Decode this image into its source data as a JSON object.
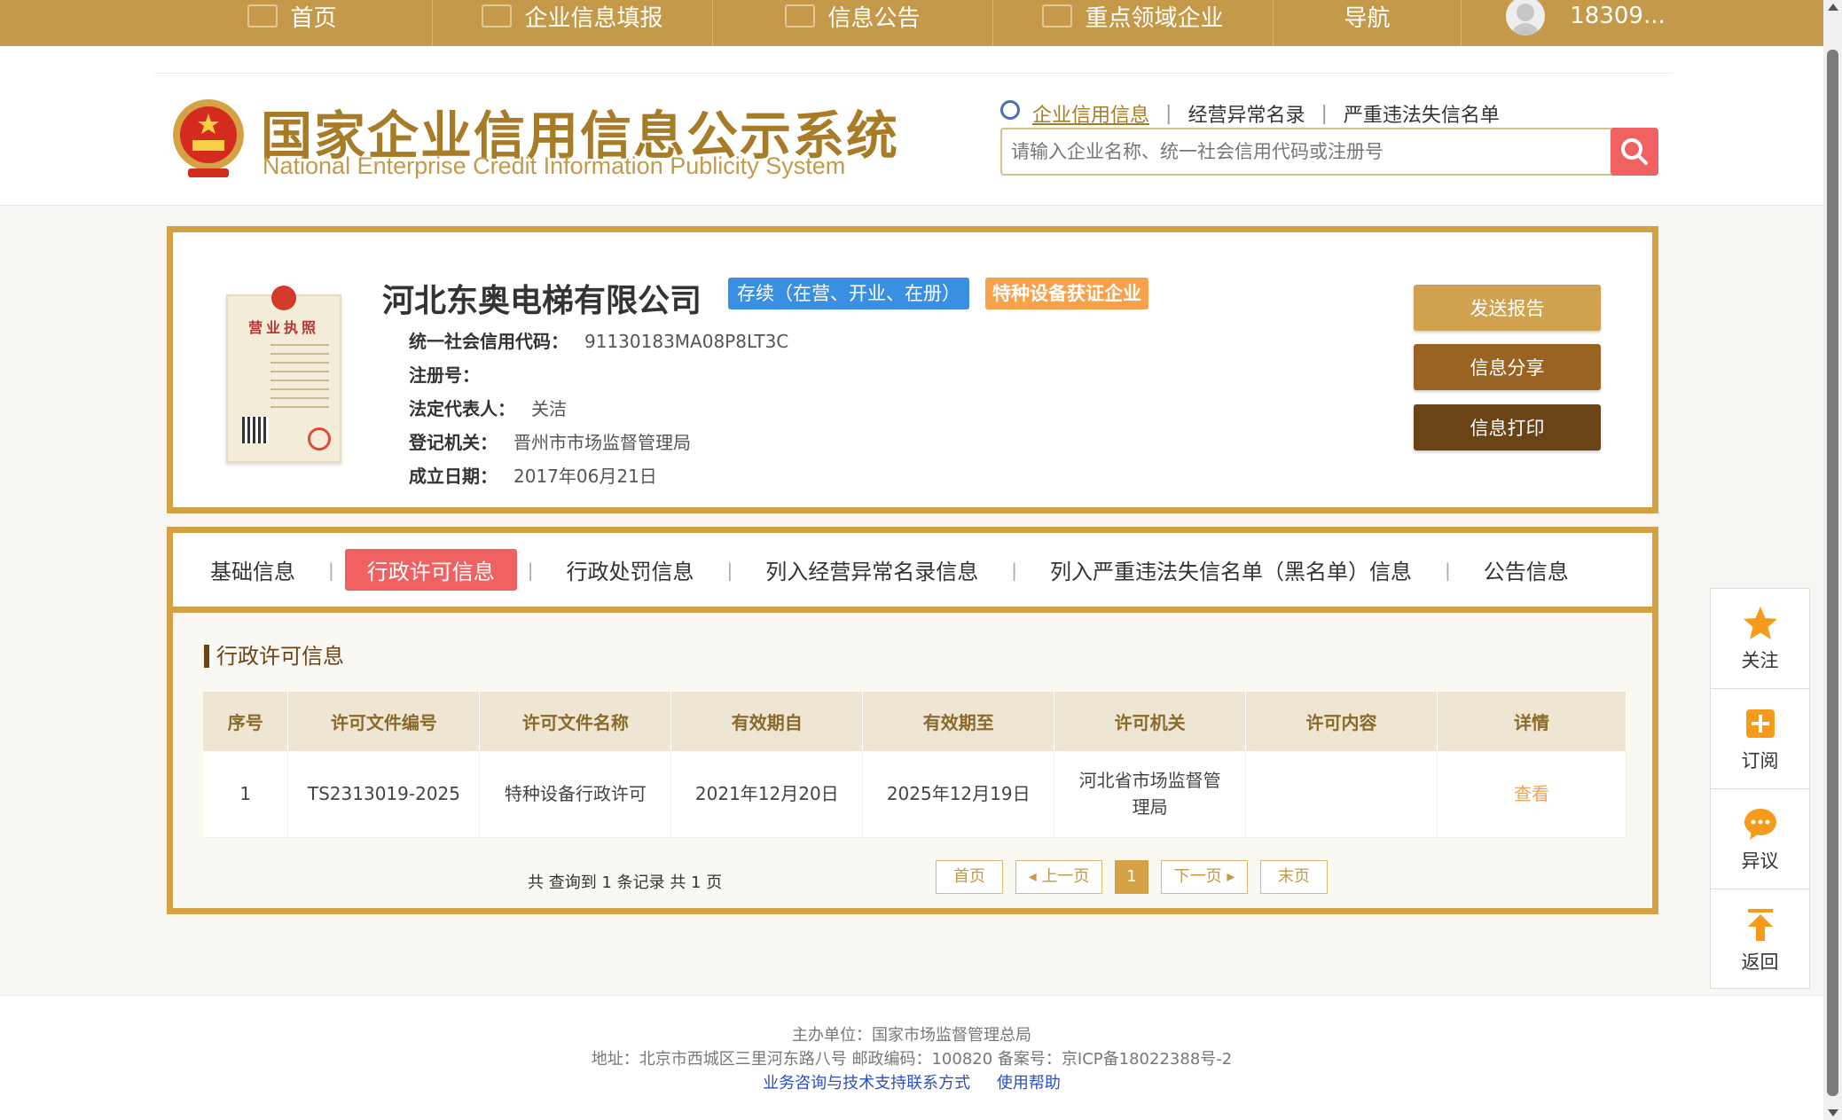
{
  "topnav": {
    "items": [
      "首页",
      "企业信息填报",
      "信息公告",
      "重点领域企业",
      "导航"
    ],
    "user": "18309..."
  },
  "header": {
    "title_cn": "国家企业信用信息公示系统",
    "title_en": "National Enterprise Credit Information Publicity System",
    "search_tabs": [
      "企业信用信息",
      "经营异常名录",
      "严重违法失信名单"
    ],
    "search_placeholder": "请输入企业名称、统一社会信用代码或注册号"
  },
  "company": {
    "name": "河北东奥电梯有限公司",
    "status_badge": "存续（在营、开业、在册）",
    "tag_badge": "特种设备获证企业",
    "license_title": "营业执照",
    "fields": [
      {
        "label": "统一社会信用代码：",
        "value": "91130183MA08P8LT3C"
      },
      {
        "label": "注册号：",
        "value": ""
      },
      {
        "label": "法定代表人：",
        "value": "关洁"
      },
      {
        "label": "登记机关：",
        "value": "晋州市市场监督管理局"
      },
      {
        "label": "成立日期：",
        "value": "2017年06月21日"
      }
    ],
    "buttons": [
      "发送报告",
      "信息分享",
      "信息打印"
    ]
  },
  "tabs": {
    "items": [
      "基础信息",
      "行政许可信息",
      "行政处罚信息",
      "列入经营异常名录信息",
      "列入严重违法失信名单（黑名单）信息",
      "公告信息"
    ],
    "active": "行政许可信息"
  },
  "section": {
    "title": "行政许可信息",
    "columns": [
      "序号",
      "许可文件编号",
      "许可文件名称",
      "有效期自",
      "有效期至",
      "许可机关",
      "许可内容",
      "详情"
    ],
    "rows": [
      [
        "1",
        "TS2313019-2025",
        "特种设备行政许可",
        "2021年12月20日",
        "2025年12月19日",
        "河北省市场监督管理局",
        "",
        "查看"
      ]
    ],
    "pager_info": "共 查询到 1 条记录 共 1 页",
    "pager": {
      "first": "首页",
      "prev": "上一页",
      "current": "1",
      "next": "下一页",
      "last": "末页"
    }
  },
  "float_menu": [
    "关注",
    "订阅",
    "异议",
    "返回"
  ],
  "footer": {
    "line1": "主办单位：国家市场监督管理总局",
    "line2": "地址：北京市西城区三里河东路八号   邮政编码：100820   备案号：京ICP备18022388号-2",
    "links": [
      "业务咨询与技术支持联系方式",
      "使用帮助"
    ]
  },
  "colors": {
    "gold": "#c49a4a",
    "border": "#d4a245",
    "active_tab": "#f06262",
    "badge_blue": "#3b8fe3",
    "badge_orange": "#f7a14b"
  }
}
